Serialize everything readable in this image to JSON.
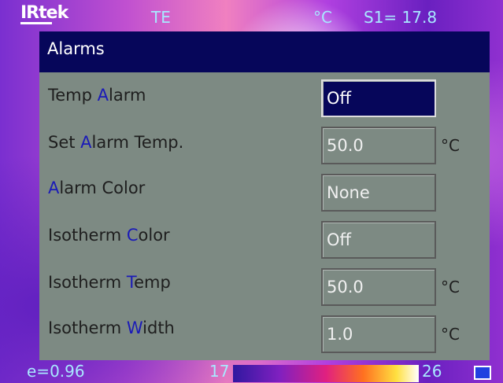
{
  "status_bar": {
    "brand": "IRtek",
    "mode": "TE",
    "unit": "°C",
    "spot_reading": "S1= 17.8"
  },
  "dialog": {
    "title": "Alarms",
    "rows": [
      {
        "label_pre": "Temp ",
        "label_accent": "A",
        "label_post": "larm",
        "value": "Off",
        "unit": "",
        "selected": true
      },
      {
        "label_pre": "Set ",
        "label_accent": "A",
        "label_post": "larm Temp.",
        "value": "50.0",
        "unit": "°C",
        "selected": false
      },
      {
        "label_pre": "",
        "label_accent": "A",
        "label_post": "larm Color",
        "value": "None",
        "unit": "",
        "selected": false
      },
      {
        "label_pre": "Isotherm ",
        "label_accent": "C",
        "label_post": "olor",
        "value": "Off",
        "unit": "",
        "selected": false
      },
      {
        "label_pre": "Isotherm ",
        "label_accent": "T",
        "label_post": "emp",
        "value": "50.0",
        "unit": "°C",
        "selected": false
      },
      {
        "label_pre": "Isotherm ",
        "label_accent": "W",
        "label_post": "idth",
        "value": "1.0",
        "unit": "°C",
        "selected": false
      }
    ]
  },
  "footer": {
    "emissivity": "e=0.96",
    "scale_min": "17",
    "scale_max": "26"
  },
  "colors": {
    "dialog_header": "#06065a",
    "dialog_body": "#7d8a83",
    "label_accent": "#1a1ab8",
    "overlay_text": "#a8e8ff"
  },
  "icons": {
    "palette_indicator": "palette-indicator-icon"
  }
}
